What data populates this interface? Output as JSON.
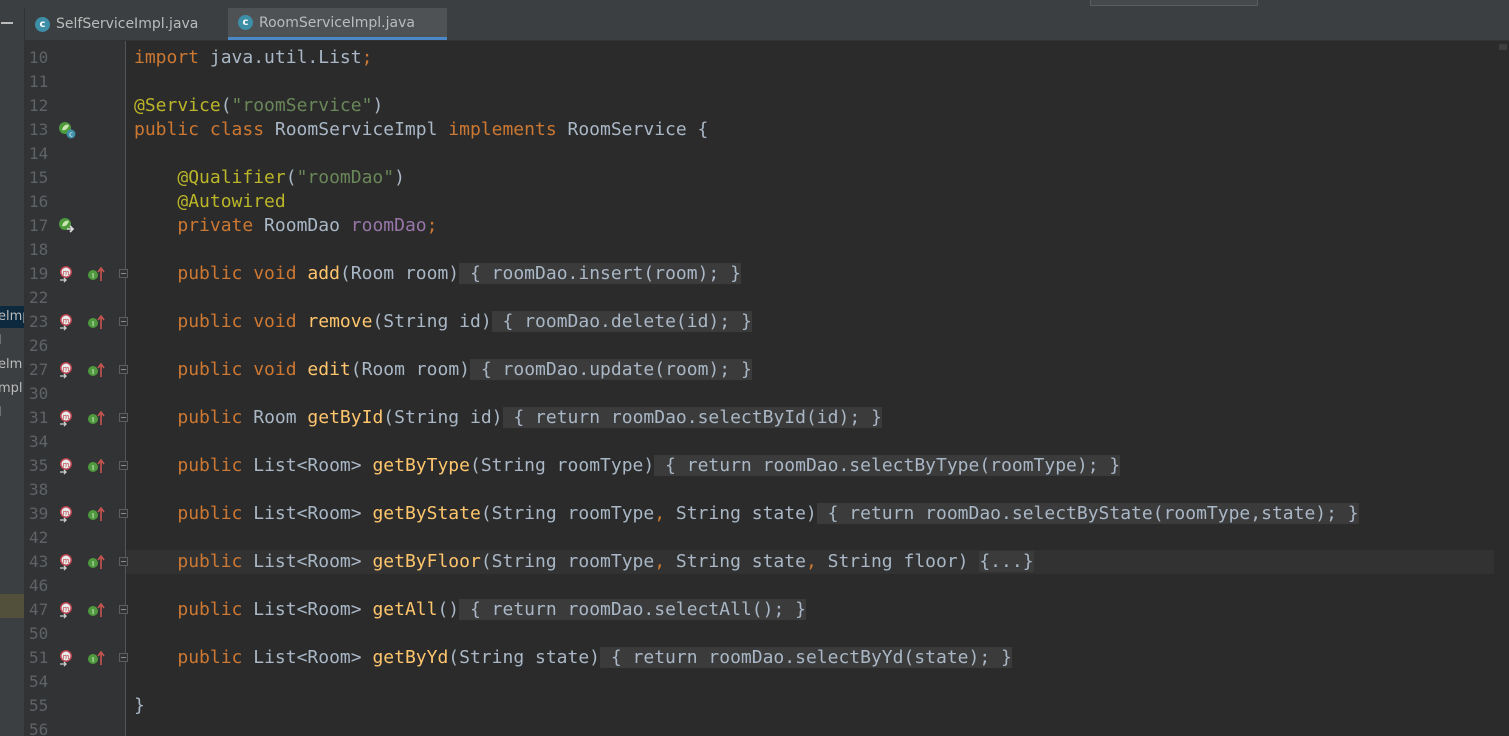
{
  "tabs": [
    {
      "label": "SelfServiceImpl.java",
      "icon": "class-icon",
      "icon_letter": "c",
      "active": false
    },
    {
      "label": "RoomServiceImpl.java",
      "icon": "class-icon",
      "icon_letter": "c",
      "active": true
    }
  ],
  "project_tree": {
    "items": [
      "elmp",
      "l",
      "elm",
      "mpl",
      "l"
    ]
  },
  "colors": {
    "keyword": "#cc7832",
    "annotation": "#bbb529",
    "string": "#6a8759",
    "field": "#9876aa",
    "method": "#ffc66d",
    "text": "#a9b7c6",
    "line_number": "#606366",
    "background": "#2b2b2b",
    "gutter": "#313335"
  },
  "editor": {
    "lines": [
      {
        "n": "10",
        "tokens": [
          [
            "k",
            "import"
          ],
          [
            "t",
            " java.util.List"
          ],
          [
            "k",
            ";"
          ]
        ]
      },
      {
        "n": "11",
        "tokens": []
      },
      {
        "n": "12",
        "tokens": [
          [
            "a",
            "@Service"
          ],
          [
            "t",
            "("
          ],
          [
            "s",
            "\"roomService\""
          ],
          [
            "t",
            ")"
          ]
        ]
      },
      {
        "n": "13",
        "tokens": [
          [
            "k",
            "public class"
          ],
          [
            "t",
            " RoomServiceImpl "
          ],
          [
            "k",
            "implements"
          ],
          [
            "t",
            " RoomService {"
          ]
        ]
      },
      {
        "n": "14",
        "tokens": []
      },
      {
        "n": "15",
        "tokens": [
          [
            "t",
            "    "
          ],
          [
            "a",
            "@Qualifier"
          ],
          [
            "t",
            "("
          ],
          [
            "s",
            "\"roomDao\""
          ],
          [
            "t",
            ")"
          ]
        ]
      },
      {
        "n": "16",
        "tokens": [
          [
            "t",
            "    "
          ],
          [
            "a",
            "@Autowired"
          ]
        ]
      },
      {
        "n": "17",
        "tokens": [
          [
            "t",
            "    "
          ],
          [
            "k",
            "private"
          ],
          [
            "t",
            " RoomDao "
          ],
          [
            "f",
            "roomDao"
          ],
          [
            "k",
            ";"
          ]
        ]
      },
      {
        "n": "18",
        "tokens": []
      },
      {
        "n": "19",
        "tokens": [
          [
            "t",
            "    "
          ],
          [
            "k",
            "public void"
          ],
          [
            "t",
            " "
          ],
          [
            "m",
            "add"
          ],
          [
            "t",
            "(Room room)"
          ],
          [
            "x",
            " { "
          ],
          [
            "xf",
            "roomDao"
          ],
          [
            "x",
            ".insert(room)"
          ],
          [
            "xk",
            ";"
          ],
          [
            "x",
            " }"
          ]
        ]
      },
      {
        "n": "22",
        "tokens": []
      },
      {
        "n": "23",
        "tokens": [
          [
            "t",
            "    "
          ],
          [
            "k",
            "public void"
          ],
          [
            "t",
            " "
          ],
          [
            "m",
            "remove"
          ],
          [
            "t",
            "(String id)"
          ],
          [
            "x",
            " { "
          ],
          [
            "xf",
            "roomDao"
          ],
          [
            "x",
            ".delete(id)"
          ],
          [
            "xk",
            ";"
          ],
          [
            "x",
            " }"
          ]
        ]
      },
      {
        "n": "26",
        "tokens": []
      },
      {
        "n": "27",
        "tokens": [
          [
            "t",
            "    "
          ],
          [
            "k",
            "public void"
          ],
          [
            "t",
            " "
          ],
          [
            "m",
            "edit"
          ],
          [
            "t",
            "(Room room)"
          ],
          [
            "x",
            " { "
          ],
          [
            "xf",
            "roomDao"
          ],
          [
            "x",
            ".update(room)"
          ],
          [
            "xk",
            ";"
          ],
          [
            "x",
            " }"
          ]
        ]
      },
      {
        "n": "30",
        "tokens": []
      },
      {
        "n": "31",
        "tokens": [
          [
            "t",
            "    "
          ],
          [
            "k",
            "public"
          ],
          [
            "t",
            " Room "
          ],
          [
            "m",
            "getById"
          ],
          [
            "t",
            "(String id)"
          ],
          [
            "x",
            " { "
          ],
          [
            "xk",
            "return"
          ],
          [
            "x",
            " "
          ],
          [
            "xf",
            "roomDao"
          ],
          [
            "x",
            ".selectById(id)"
          ],
          [
            "xk",
            ";"
          ],
          [
            "x",
            " }"
          ]
        ]
      },
      {
        "n": "34",
        "tokens": []
      },
      {
        "n": "35",
        "tokens": [
          [
            "t",
            "    "
          ],
          [
            "k",
            "public"
          ],
          [
            "t",
            " List<Room> "
          ],
          [
            "m",
            "getByType"
          ],
          [
            "t",
            "(String roomType)"
          ],
          [
            "x",
            " { "
          ],
          [
            "xk",
            "return"
          ],
          [
            "x",
            " "
          ],
          [
            "xf",
            "roomDao"
          ],
          [
            "x",
            ".selectByType(roomType)"
          ],
          [
            "xk",
            ";"
          ],
          [
            "x",
            " }"
          ]
        ]
      },
      {
        "n": "38",
        "tokens": []
      },
      {
        "n": "39",
        "tokens": [
          [
            "t",
            "    "
          ],
          [
            "k",
            "public"
          ],
          [
            "t",
            " List<Room> "
          ],
          [
            "m",
            "getByState"
          ],
          [
            "t",
            "(String roomType"
          ],
          [
            "k",
            ","
          ],
          [
            "t",
            " String state)"
          ],
          [
            "x",
            " { "
          ],
          [
            "xk",
            "return"
          ],
          [
            "x",
            " "
          ],
          [
            "xf",
            "roomDao"
          ],
          [
            "x",
            ".selectByState(roomType,state)"
          ],
          [
            "xk",
            ";"
          ],
          [
            "x",
            " }"
          ]
        ]
      },
      {
        "n": "42",
        "tokens": []
      },
      {
        "n": "43",
        "tokens": [
          [
            "t",
            "    "
          ],
          [
            "k",
            "public"
          ],
          [
            "t",
            " List<Room> "
          ],
          [
            "m",
            "getByFloor"
          ],
          [
            "t",
            "(String roomType"
          ],
          [
            "k",
            ","
          ],
          [
            "t",
            " String state"
          ],
          [
            "k",
            ","
          ],
          [
            "t",
            " String floor) "
          ],
          [
            "x",
            "{...}"
          ]
        ]
      },
      {
        "n": "46",
        "tokens": []
      },
      {
        "n": "47",
        "tokens": [
          [
            "t",
            "    "
          ],
          [
            "k",
            "public"
          ],
          [
            "t",
            " List<Room> "
          ],
          [
            "m",
            "getAll"
          ],
          [
            "t",
            "()"
          ],
          [
            "x",
            " { "
          ],
          [
            "xk",
            "return"
          ],
          [
            "x",
            " "
          ],
          [
            "xf",
            "roomDao"
          ],
          [
            "x",
            ".selectAll()"
          ],
          [
            "xk",
            ";"
          ],
          [
            "x",
            " }"
          ]
        ]
      },
      {
        "n": "50",
        "tokens": []
      },
      {
        "n": "51",
        "tokens": [
          [
            "t",
            "    "
          ],
          [
            "k",
            "public"
          ],
          [
            "t",
            " List<Room> "
          ],
          [
            "m",
            "getByYd"
          ],
          [
            "t",
            "(String state)"
          ],
          [
            "x",
            " { "
          ],
          [
            "xk",
            "return"
          ],
          [
            "x",
            " "
          ],
          [
            "xf",
            "roomDao"
          ],
          [
            "x",
            ".selectByYd(state)"
          ],
          [
            "xk",
            ";"
          ],
          [
            "x",
            " }"
          ]
        ]
      },
      {
        "n": "54",
        "tokens": []
      },
      {
        "n": "55",
        "tokens": [
          [
            "t",
            "}"
          ]
        ]
      },
      {
        "n": "56",
        "tokens": []
      }
    ]
  },
  "gutter_markers": {
    "13": [
      "spring-bean-icon"
    ],
    "17": [
      "spring-autowire-icon"
    ],
    "19": [
      "implements-method-icon",
      "override-up-icon"
    ],
    "23": [
      "implements-method-icon",
      "override-up-icon"
    ],
    "27": [
      "implements-method-icon",
      "override-up-icon"
    ],
    "31": [
      "implements-method-icon",
      "override-up-icon"
    ],
    "35": [
      "implements-method-icon",
      "override-up-icon"
    ],
    "39": [
      "implements-method-icon",
      "override-up-icon"
    ],
    "43": [
      "implements-method-icon",
      "override-up-icon"
    ],
    "47": [
      "implements-method-icon",
      "override-up-icon"
    ],
    "51": [
      "implements-method-icon",
      "override-up-icon"
    ]
  }
}
